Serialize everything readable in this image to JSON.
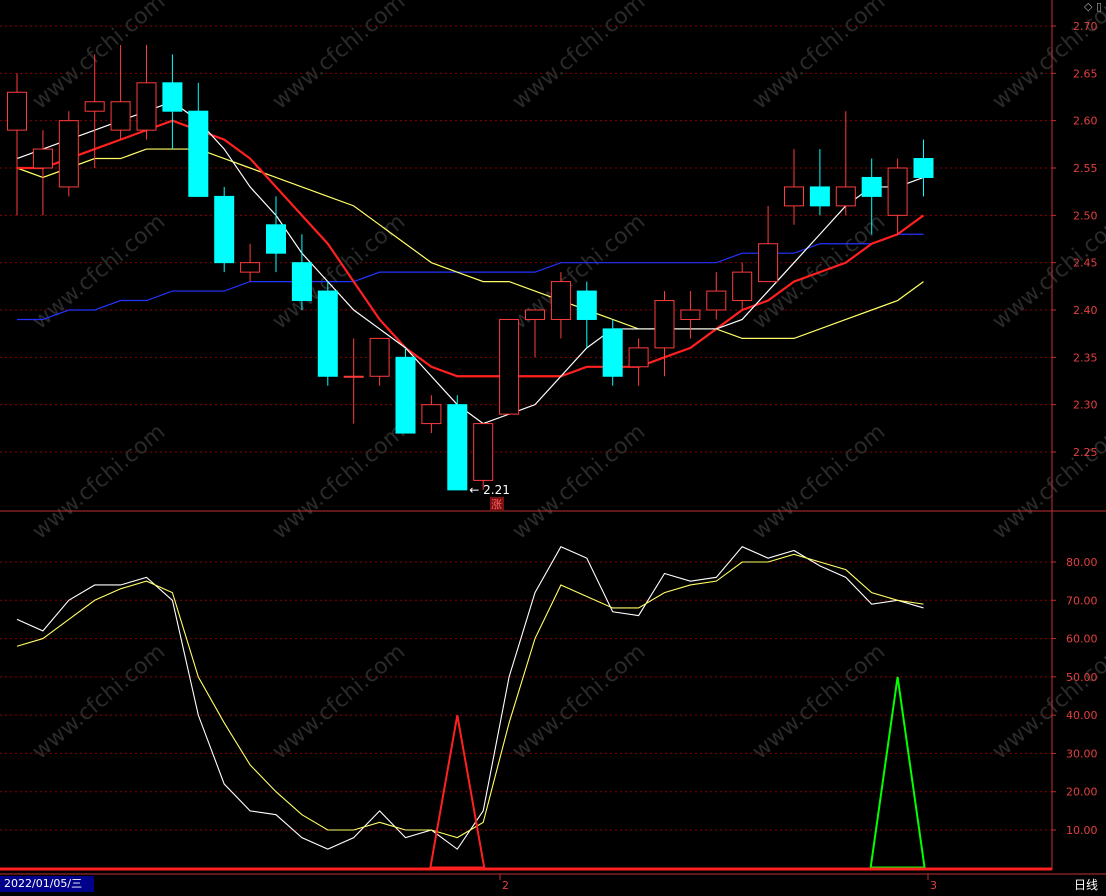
{
  "status": {
    "date": "2022/01/05/三",
    "period": "日线"
  },
  "colors": {
    "up": "#ff3b3b",
    "down": "#00ffff",
    "ma5": "#ffffff",
    "ma10": "#ff2020",
    "ma20": "#ffff66",
    "ma60": "#2233ff",
    "grid": "#8b0000",
    "axis": "#c03030",
    "k": "#ffffff",
    "d": "#ffff66",
    "buy": "#ff2020",
    "sell": "#00ff00"
  },
  "chart_data": [
    {
      "type": "candlestick",
      "ylim": [
        2.2,
        2.72
      ],
      "yticks": [
        "2.70",
        "2.65",
        "2.60",
        "2.55",
        "2.50",
        "2.45",
        "2.40",
        "2.35",
        "2.30",
        "2.25"
      ],
      "low_annotation": "2.21",
      "marker": "涨",
      "x_ticks": [
        "2",
        "3"
      ],
      "candles": [
        {
          "o": 2.59,
          "h": 2.65,
          "l": 2.5,
          "c": 2.63
        },
        {
          "o": 2.55,
          "h": 2.59,
          "l": 2.5,
          "c": 2.57
        },
        {
          "o": 2.53,
          "h": 2.61,
          "l": 2.52,
          "c": 2.6
        },
        {
          "o": 2.61,
          "h": 2.67,
          "l": 2.55,
          "c": 2.62
        },
        {
          "o": 2.59,
          "h": 2.68,
          "l": 2.58,
          "c": 2.62
        },
        {
          "o": 2.59,
          "h": 2.68,
          "l": 2.58,
          "c": 2.64
        },
        {
          "o": 2.64,
          "h": 2.67,
          "l": 2.57,
          "c": 2.61
        },
        {
          "o": 2.61,
          "h": 2.64,
          "l": 2.52,
          "c": 2.52
        },
        {
          "o": 2.52,
          "h": 2.53,
          "l": 2.44,
          "c": 2.45
        },
        {
          "o": 2.44,
          "h": 2.47,
          "l": 2.43,
          "c": 2.45
        },
        {
          "o": 2.49,
          "h": 2.52,
          "l": 2.44,
          "c": 2.46
        },
        {
          "o": 2.45,
          "h": 2.48,
          "l": 2.4,
          "c": 2.41
        },
        {
          "o": 2.42,
          "h": 2.43,
          "l": 2.32,
          "c": 2.33
        },
        {
          "o": 2.33,
          "h": 2.37,
          "l": 2.28,
          "c": 2.33
        },
        {
          "o": 2.33,
          "h": 2.37,
          "l": 2.32,
          "c": 2.37
        },
        {
          "o": 2.35,
          "h": 2.36,
          "l": 2.27,
          "c": 2.27
        },
        {
          "o": 2.28,
          "h": 2.31,
          "l": 2.27,
          "c": 2.3
        },
        {
          "o": 2.3,
          "h": 2.31,
          "l": 2.21,
          "c": 2.21
        },
        {
          "o": 2.22,
          "h": 2.28,
          "l": 2.21,
          "c": 2.28
        },
        {
          "o": 2.29,
          "h": 2.39,
          "l": 2.29,
          "c": 2.39
        },
        {
          "o": 2.39,
          "h": 2.4,
          "l": 2.35,
          "c": 2.4
        },
        {
          "o": 2.39,
          "h": 2.44,
          "l": 2.37,
          "c": 2.43
        },
        {
          "o": 2.42,
          "h": 2.43,
          "l": 2.36,
          "c": 2.39
        },
        {
          "o": 2.38,
          "h": 2.39,
          "l": 2.32,
          "c": 2.33
        },
        {
          "o": 2.34,
          "h": 2.37,
          "l": 2.32,
          "c": 2.36
        },
        {
          "o": 2.36,
          "h": 2.42,
          "l": 2.33,
          "c": 2.41
        },
        {
          "o": 2.39,
          "h": 2.42,
          "l": 2.37,
          "c": 2.4
        },
        {
          "o": 2.4,
          "h": 2.44,
          "l": 2.39,
          "c": 2.42
        },
        {
          "o": 2.41,
          "h": 2.45,
          "l": 2.4,
          "c": 2.44
        },
        {
          "o": 2.43,
          "h": 2.51,
          "l": 2.43,
          "c": 2.47
        },
        {
          "o": 2.51,
          "h": 2.57,
          "l": 2.49,
          "c": 2.53
        },
        {
          "o": 2.53,
          "h": 2.57,
          "l": 2.5,
          "c": 2.51
        },
        {
          "o": 2.51,
          "h": 2.61,
          "l": 2.5,
          "c": 2.53
        },
        {
          "o": 2.54,
          "h": 2.56,
          "l": 2.48,
          "c": 2.52
        },
        {
          "o": 2.5,
          "h": 2.56,
          "l": 2.48,
          "c": 2.55
        },
        {
          "o": 2.56,
          "h": 2.58,
          "l": 2.52,
          "c": 2.54
        }
      ],
      "ma5": [
        2.56,
        2.57,
        2.58,
        2.59,
        2.6,
        2.61,
        2.62,
        2.6,
        2.57,
        2.53,
        2.5,
        2.46,
        2.43,
        2.4,
        2.38,
        2.36,
        2.33,
        2.3,
        2.28,
        2.29,
        2.3,
        2.33,
        2.36,
        2.38,
        2.38,
        2.38,
        2.38,
        2.38,
        2.39,
        2.42,
        2.45,
        2.48,
        2.51,
        2.53,
        2.53,
        2.54
      ],
      "ma10": [
        2.55,
        2.55,
        2.56,
        2.57,
        2.58,
        2.59,
        2.6,
        2.59,
        2.58,
        2.56,
        2.53,
        2.5,
        2.47,
        2.43,
        2.39,
        2.36,
        2.34,
        2.33,
        2.33,
        2.33,
        2.33,
        2.33,
        2.34,
        2.34,
        2.34,
        2.35,
        2.36,
        2.38,
        2.4,
        2.41,
        2.43,
        2.44,
        2.45,
        2.47,
        2.48,
        2.5
      ],
      "ma20": [
        2.55,
        2.54,
        2.55,
        2.56,
        2.56,
        2.57,
        2.57,
        2.57,
        2.56,
        2.55,
        2.54,
        2.53,
        2.52,
        2.51,
        2.49,
        2.47,
        2.45,
        2.44,
        2.43,
        2.43,
        2.42,
        2.41,
        2.4,
        2.39,
        2.38,
        2.38,
        2.38,
        2.38,
        2.37,
        2.37,
        2.37,
        2.38,
        2.39,
        2.4,
        2.41,
        2.43
      ],
      "ma60": [
        2.39,
        2.39,
        2.4,
        2.4,
        2.41,
        2.41,
        2.42,
        2.42,
        2.42,
        2.43,
        2.43,
        2.43,
        2.43,
        2.43,
        2.44,
        2.44,
        2.44,
        2.44,
        2.44,
        2.44,
        2.44,
        2.45,
        2.45,
        2.45,
        2.45,
        2.45,
        2.45,
        2.45,
        2.46,
        2.46,
        2.46,
        2.47,
        2.47,
        2.47,
        2.48,
        2.48
      ]
    },
    {
      "type": "line",
      "ylim": [
        0,
        92
      ],
      "yticks": [
        "80.00",
        "70.00",
        "60.00",
        "50.00",
        "40.00",
        "30.00",
        "20.00",
        "10.00"
      ],
      "series": [
        {
          "key": "k",
          "values": [
            65,
            62,
            70,
            74,
            74,
            76,
            70,
            40,
            22,
            15,
            14,
            8,
            5,
            8,
            15,
            8,
            10,
            5,
            15,
            50,
            72,
            84,
            81,
            67,
            66,
            77,
            75,
            76,
            84,
            81,
            83,
            79,
            76,
            69,
            70,
            68
          ]
        },
        {
          "key": "d",
          "values": [
            58,
            60,
            65,
            70,
            73,
            75,
            72,
            50,
            38,
            27,
            20,
            14,
            10,
            10,
            12,
            10,
            10,
            8,
            12,
            38,
            60,
            74,
            71,
            68,
            68,
            72,
            74,
            75,
            80,
            80,
            82,
            80,
            78,
            72,
            70,
            69
          ]
        }
      ],
      "signals": [
        {
          "index": 17,
          "value": 40,
          "kind": "buy"
        },
        {
          "index": 34,
          "value": 50,
          "kind": "sell"
        }
      ]
    }
  ]
}
